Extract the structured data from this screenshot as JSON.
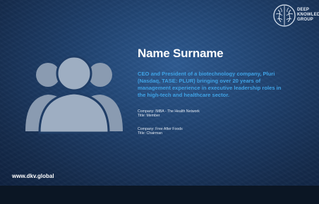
{
  "brand": {
    "logo_text": "DEEP\nKNOWLEDGE\nGROUP",
    "website": "www.dkv.global"
  },
  "profile": {
    "name": "Name Surname",
    "bio": "CEO and President of a biotechnology company, Pluri (Nasdaq, TASE: PLUR) bringing over 20 years of management experience in executive leadership roles in the high-tech and healthcare sector.",
    "roles": [
      {
        "company": "Company: IMBA - The Health Network",
        "title": "Title: Member"
      },
      {
        "company": "Company: Free After Foods",
        "title": "Title: Chairman"
      }
    ]
  },
  "colors": {
    "background": "#1e3f6b",
    "accent": "#3fa3e6",
    "text": "#ffffff"
  },
  "icons": {
    "avatar": "person-group-icon",
    "logo": "brain-icon"
  }
}
